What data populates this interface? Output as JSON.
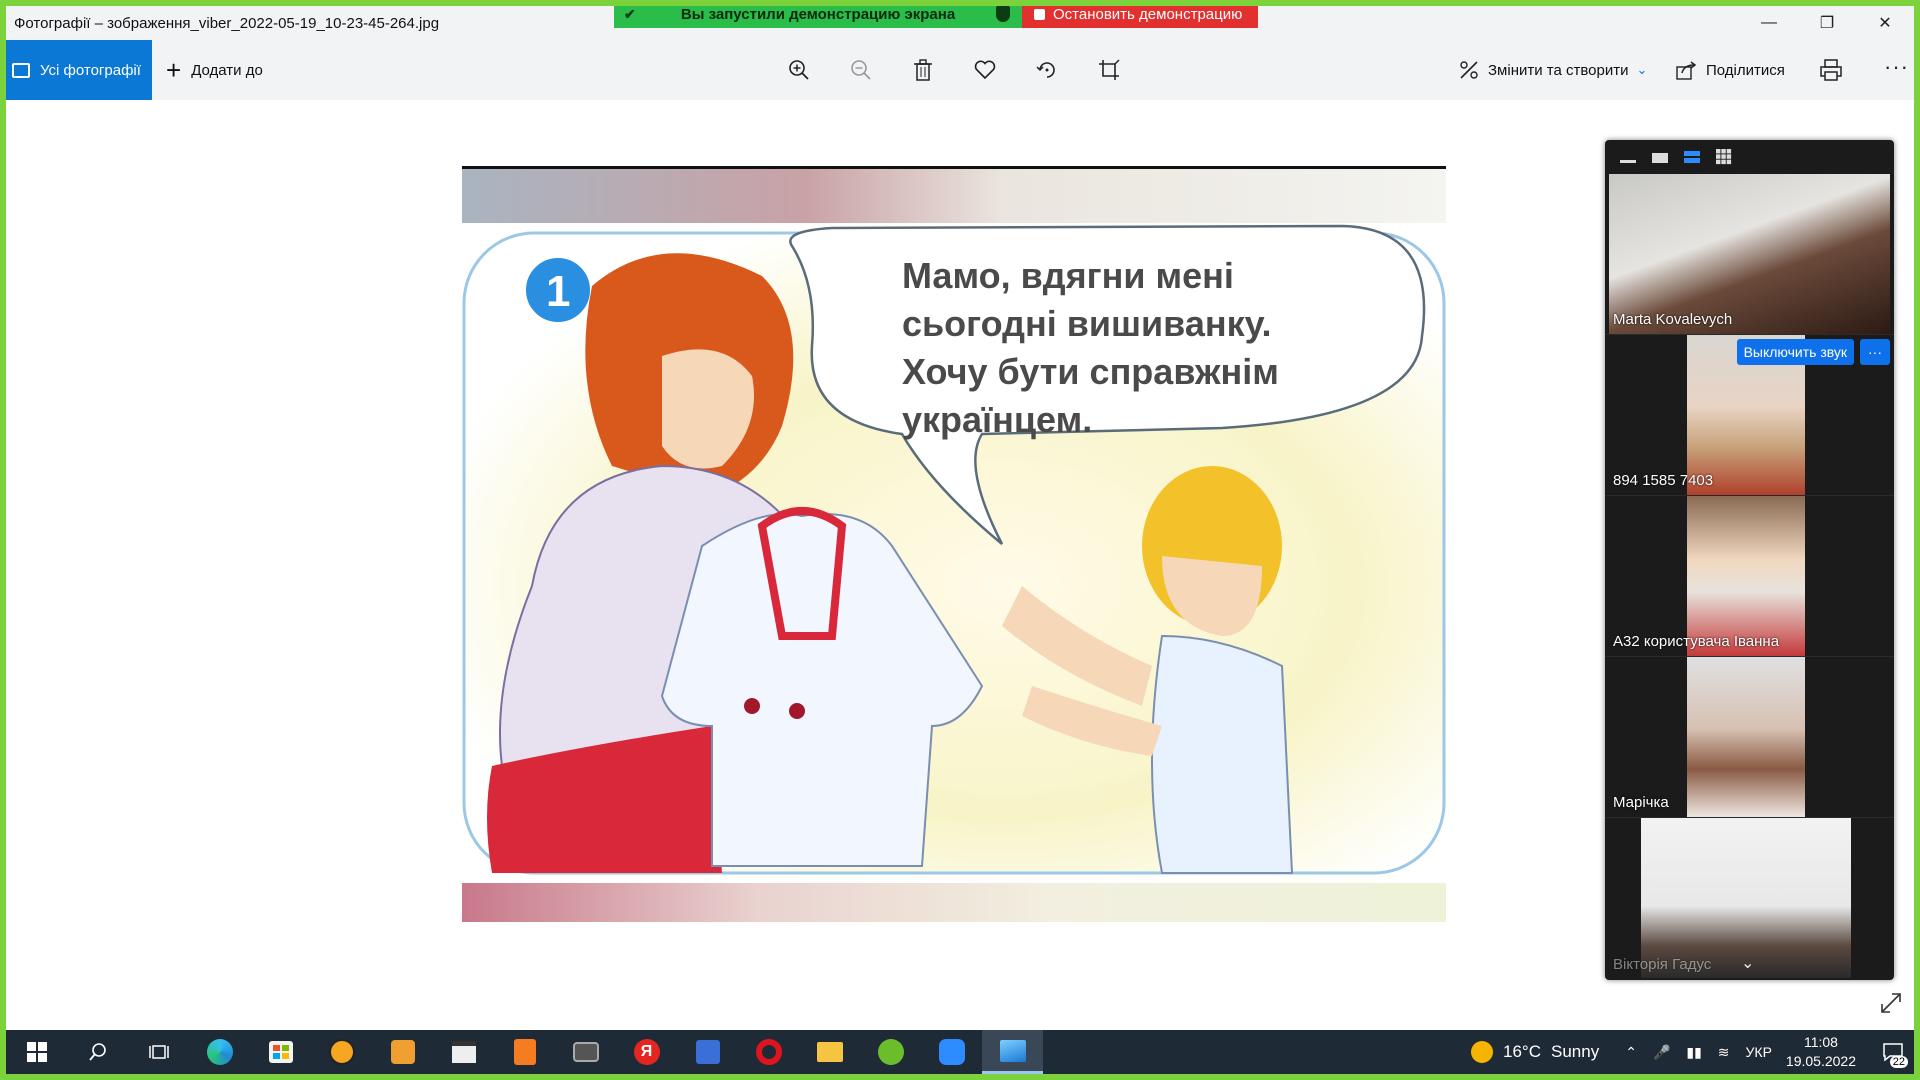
{
  "window": {
    "title": "Фотографії – зображення_viber_2022-05-19_10-23-45-264.jpg"
  },
  "share_banner": {
    "status": "Вы запустили демонстрацию экрана",
    "stop_label": "Остановить демонстрацию"
  },
  "toolbar": {
    "all_photos": "Усі фотографії",
    "add_to": "Додати до",
    "edit_create": "Змінити та створити",
    "share": "Поділитися",
    "more": "···"
  },
  "photo": {
    "speech_lines": [
      "Мамо, вдягни мені",
      "сьогодні вишиванку.",
      "Хочу бути справжнім",
      "українцем."
    ],
    "badge_number": "1"
  },
  "video_panel": {
    "mute_label": "Выключить звук",
    "more_label": "···",
    "participants": [
      {
        "name": "Marta Kovalevych"
      },
      {
        "name": "894 1585 7403"
      },
      {
        "name": "A32 користувача Іванна"
      },
      {
        "name": "Марічка"
      },
      {
        "name": "Вікторія Гадус"
      }
    ]
  },
  "taskbar": {
    "weather_temp": "16°C",
    "weather_text": "Sunny",
    "language": "УКР",
    "time": "11:08",
    "date": "19.05.2022",
    "notifications": "22"
  },
  "colors": {
    "accent": "#0a78d4",
    "share_green": "#2bbd4a",
    "share_red": "#e2302f",
    "frame_green": "#7bd23a",
    "zoom_blue": "#0e71eb"
  }
}
